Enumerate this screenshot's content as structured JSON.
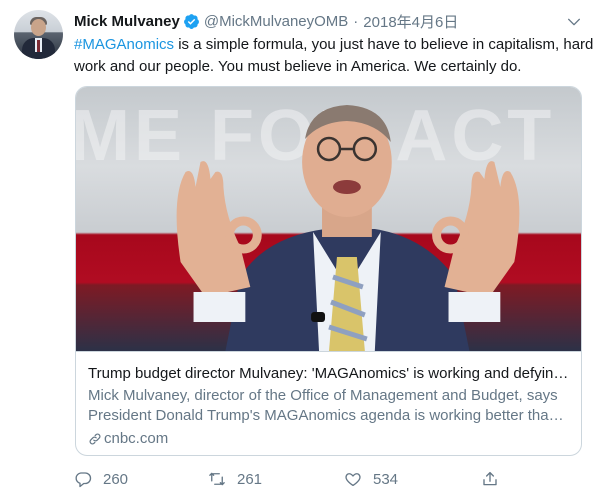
{
  "author": {
    "name": "Mick Mulvaney",
    "handle": "@MickMulvaneyOMB",
    "separator": "·",
    "date": "2018年4月6日"
  },
  "tweet": {
    "hashtag": "#MAGAnomics",
    "text": " is a simple formula, you just have to believe in capitalism, hard work and our people. You must believe in America. We certainly do."
  },
  "card": {
    "background_text": "ME FOR ACT",
    "title": "Trump budget director Mulvaney: 'MAGAnomics' is working and defying critics",
    "description_line1": "Mick Mulvaney, director of the Office of Management and Budget, says",
    "description_line2": "President Donald Trump's MAGAnomics agenda is working better than its critics expected",
    "domain": "cnbc.com"
  },
  "actions": {
    "reply_count": "260",
    "retweet_count": "261",
    "like_count": "534"
  },
  "icons": {
    "verified": "verified-badge-icon",
    "caret": "chevron-down-icon",
    "link": "link-icon",
    "reply": "reply-icon",
    "retweet": "retweet-icon",
    "like": "heart-icon",
    "share": "share-icon"
  },
  "colors": {
    "link_blue": "#1b95e0",
    "verified_blue": "#1da1f2",
    "secondary_text": "#657786",
    "border": "#ccd6dd"
  }
}
